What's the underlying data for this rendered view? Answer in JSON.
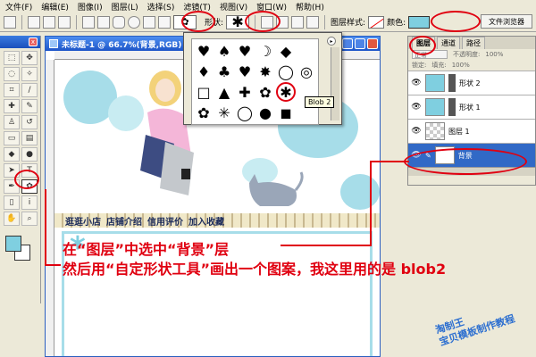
{
  "menu": [
    "文件(F)",
    "编辑(E)",
    "图像(I)",
    "图层(L)",
    "选择(S)",
    "滤镜(T)",
    "视图(V)",
    "窗口(W)",
    "帮助(H)"
  ],
  "options": {
    "shape_label": "形状:",
    "style_label": "图层样式:",
    "color_label": "颜色:",
    "file_browser_label": "文件浏览器",
    "color": "#7fcfe0"
  },
  "document": {
    "title": "未标题-1 @ 66.7%(背景,RGB)"
  },
  "canvas": {
    "nav_items": [
      "逛逛小店",
      "店铺介绍",
      "信用评价",
      "加入收藏"
    ],
    "asterisk": "*"
  },
  "layers_panel": {
    "tabs": [
      "图层",
      "通道",
      "路径"
    ],
    "blend_mode": "正常",
    "opacity_label": "不透明度:",
    "opacity_value": "100%",
    "lock_label": "锁定:",
    "fill_label": "填充:",
    "fill_value": "100%",
    "layers": [
      {
        "name": "形状 2",
        "selected": false
      },
      {
        "name": "形状 1",
        "selected": false
      },
      {
        "name": "图层 1",
        "selected": false
      },
      {
        "name": "背景",
        "selected": true
      }
    ]
  },
  "shape_popup": {
    "shapes": [
      "♥",
      "♠",
      "♥",
      "☽",
      "◆",
      "♦",
      "♣",
      "♥",
      "✸",
      "◯",
      "◎",
      "□",
      "▲",
      "✚",
      "✿",
      "✱",
      "✿",
      "✳",
      "◯",
      "●",
      "◼"
    ],
    "tooltip": "Blob 2"
  },
  "instructions": {
    "line1": "在“图层”中选中“背景”层",
    "line2": "然后用“自定形状工具”画出一个图案，我这里用的是 blob2"
  },
  "watermark": {
    "line1": "淘制王",
    "line2": "宝贝模板制作教程"
  }
}
